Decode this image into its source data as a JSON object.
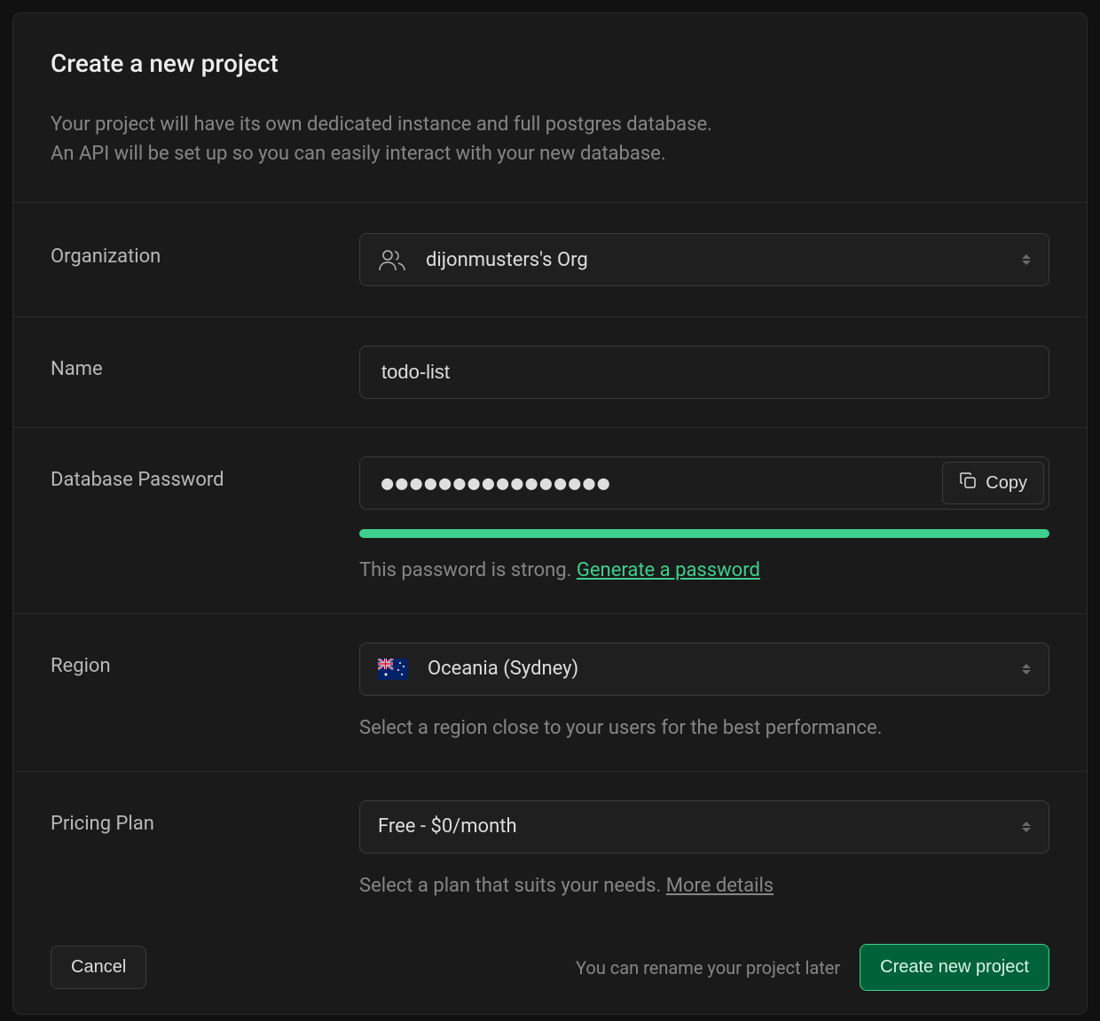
{
  "header": {
    "title": "Create a new project",
    "description_line1": "Your project will have its own dedicated instance and full postgres database.",
    "description_line2": "An API will be set up so you can easily interact with your new database."
  },
  "form": {
    "organization": {
      "label": "Organization",
      "value": "dijonmusters's Org"
    },
    "name": {
      "label": "Name",
      "value": "todo-list"
    },
    "password": {
      "label": "Database Password",
      "value": "●●●●●●●●●●●●●●●●",
      "copy_label": "Copy",
      "strength_text": "This password is strong. ",
      "generate_link": "Generate a password"
    },
    "region": {
      "label": "Region",
      "value": "Oceania (Sydney)",
      "helper": "Select a region close to your users for the best performance."
    },
    "pricing": {
      "label": "Pricing Plan",
      "value": "Free - $0/month",
      "helper_text": "Select a plan that suits your needs. ",
      "details_link": "More details"
    }
  },
  "footer": {
    "cancel": "Cancel",
    "hint": "You can rename your project later",
    "create": "Create new project"
  }
}
